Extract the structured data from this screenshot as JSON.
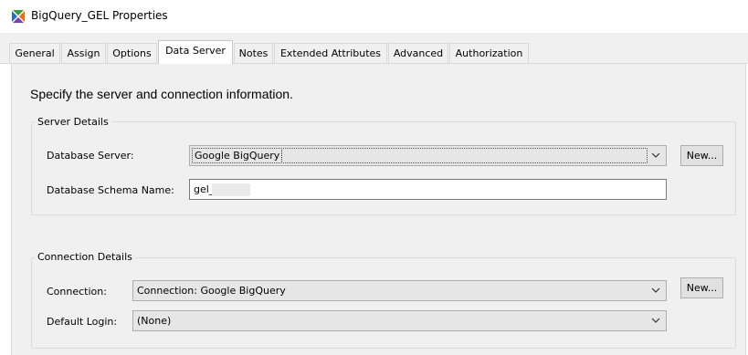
{
  "window": {
    "title": "BigQuery_GEL Properties",
    "icon": "sas-object-icon"
  },
  "tabs": [
    {
      "label": "General"
    },
    {
      "label": "Assign"
    },
    {
      "label": "Options"
    },
    {
      "label": "Data Server",
      "active": true
    },
    {
      "label": "Notes"
    },
    {
      "label": "Extended Attributes"
    },
    {
      "label": "Advanced"
    },
    {
      "label": "Authorization"
    }
  ],
  "instruction": "Specify the server and connection information.",
  "server_details": {
    "legend": "Server Details",
    "database_server_label": "Database Server:",
    "database_server_value": "Google BigQuery",
    "new_button": "New...",
    "schema_label": "Database Schema Name:",
    "schema_value": "gel_"
  },
  "connection_details": {
    "legend": "Connection Details",
    "connection_label": "Connection:",
    "connection_value": "Connection: Google BigQuery",
    "new_button": "New...",
    "login_label": "Default Login:",
    "login_value": "(None)"
  },
  "colors": {
    "panel": "#f0f0f0",
    "combo_bg": "#e6e6e6",
    "border": "#adadad"
  }
}
